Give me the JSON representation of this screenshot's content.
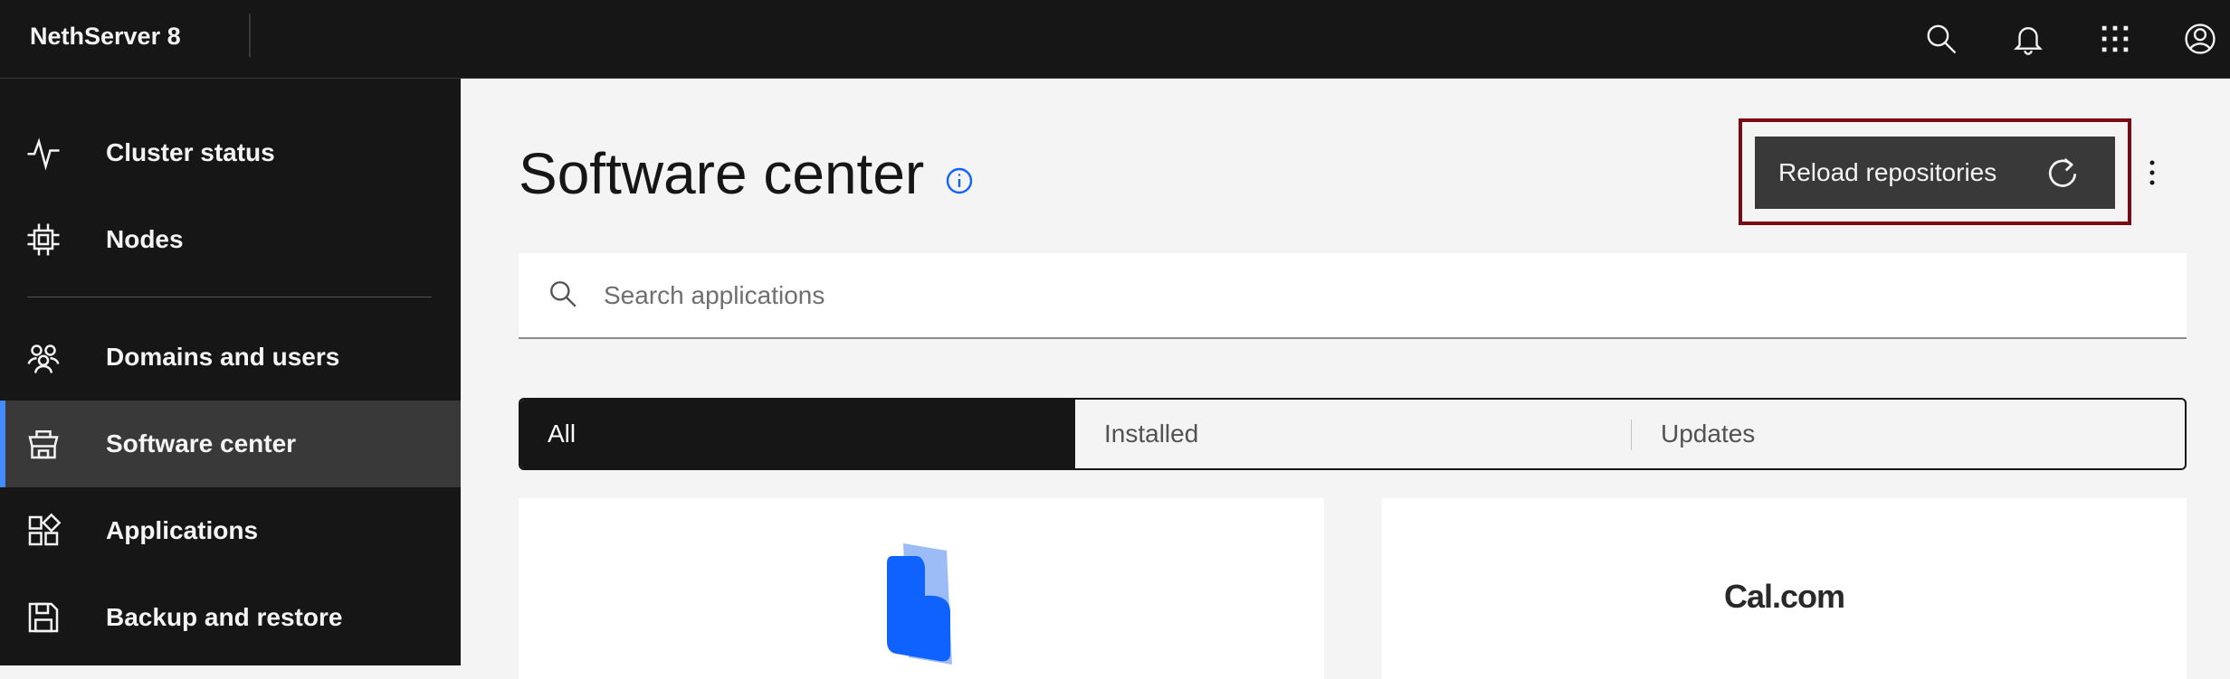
{
  "header": {
    "brand": "NethServer 8",
    "icons": [
      "search-icon",
      "notification-icon",
      "app-switcher-icon",
      "user-avatar-icon"
    ]
  },
  "sidebar": {
    "items": [
      {
        "label": "Cluster status",
        "icon": "activity-icon"
      },
      {
        "label": "Nodes",
        "icon": "chip-icon"
      },
      {
        "label": "Domains and users",
        "icon": "users-icon"
      },
      {
        "label": "Software center",
        "icon": "store-icon",
        "active": true
      },
      {
        "label": "Applications",
        "icon": "apps-icon"
      },
      {
        "label": "Backup and restore",
        "icon": "save-icon"
      }
    ]
  },
  "main": {
    "title": "Software center",
    "reload_label": "Reload repositories",
    "search_placeholder": "Search applications",
    "search_value": "",
    "tabs": [
      {
        "label": "All",
        "active": true
      },
      {
        "label": "Installed"
      },
      {
        "label": "Updates"
      }
    ],
    "cards": [
      {
        "logo": "blue-doc-logo"
      },
      {
        "logo_text": "Cal.com"
      }
    ]
  },
  "colors": {
    "header_bg": "#161616",
    "sidebar_active": "#393939",
    "accent": "#4589ff",
    "info_blue": "#0f62fe",
    "highlight": "#7a0a14"
  }
}
